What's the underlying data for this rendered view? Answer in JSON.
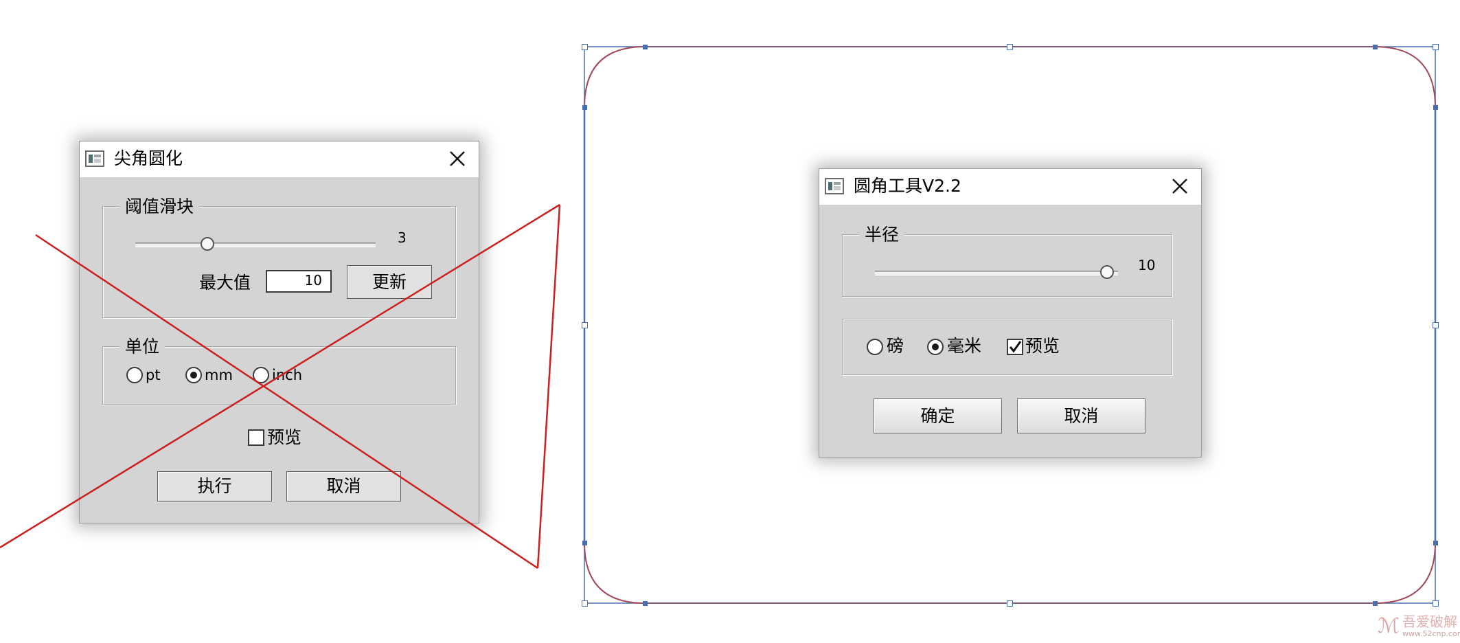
{
  "old_dialog": {
    "title": "尖角圆化",
    "threshold_group": {
      "label": "阈值滑块",
      "slider_value": "3",
      "slider_fraction": 0.29,
      "max_label": "最大值",
      "max_value": "10",
      "update_button": "更新"
    },
    "unit_group": {
      "label": "单位",
      "options": [
        {
          "label": "pt",
          "checked": false
        },
        {
          "label": "mm",
          "checked": true
        },
        {
          "label": "inch",
          "checked": false
        }
      ]
    },
    "preview_label": "预览",
    "preview_checked": false,
    "execute_button": "执行",
    "cancel_button": "取消"
  },
  "new_dialog": {
    "title": "圆角工具V2.2",
    "radius_group": {
      "label": "半径",
      "slider_value": "10",
      "slider_fraction": 1.0
    },
    "options": {
      "pound_label": "磅",
      "pound_checked": false,
      "mm_label": "毫米",
      "mm_checked": true,
      "preview_label": "预览",
      "preview_checked": true
    },
    "ok_button": "确定",
    "cancel_button": "取消"
  },
  "watermark": {
    "logo_glyph": "ℳ",
    "text": "吾爱破解",
    "url": "www.52cnp.com"
  },
  "colors": {
    "dialog_bg": "#d4d4d4",
    "cross_line": "#cc1f1f",
    "selection_blue": "#4a6fb0",
    "shape_stroke": "#a04a5a"
  }
}
